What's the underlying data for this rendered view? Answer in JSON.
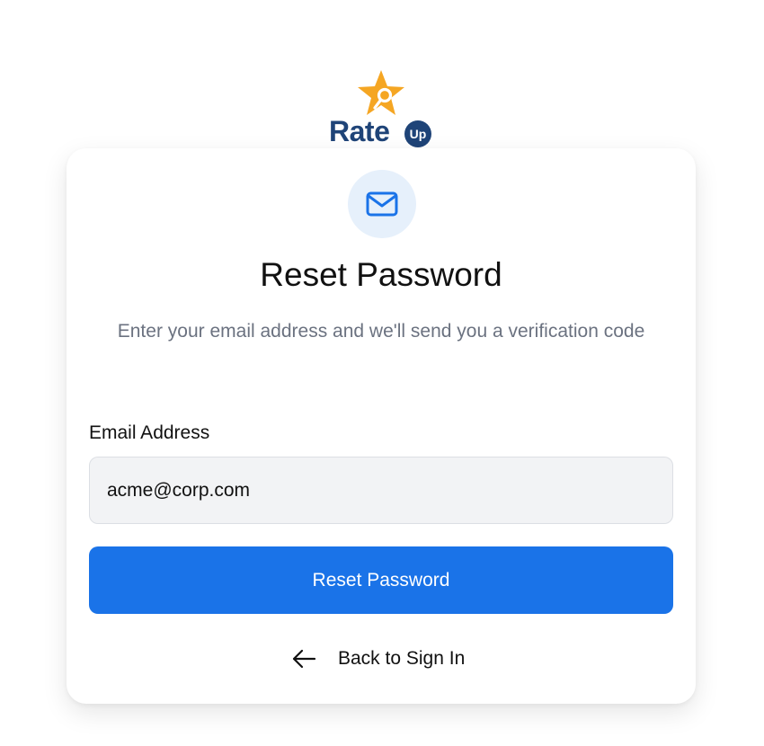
{
  "brand": {
    "logo_text": "Rate",
    "logo_badge": "Up",
    "star_color": "#f5a623",
    "primary_color": "#1f4478"
  },
  "icons": {
    "header_icon": "mail-icon",
    "back_icon": "arrow-left-icon"
  },
  "card": {
    "title": "Reset Password",
    "subtitle": "Enter your email address and we'll send you a verification code"
  },
  "form": {
    "email_label": "Email Address",
    "email_value": "acme@corp.com",
    "submit_label": "Reset Password"
  },
  "footer": {
    "back_label": "Back to Sign In"
  },
  "colors": {
    "accent": "#1a73e8",
    "icon_bg": "#e6f0fb",
    "muted_text": "#6b7280"
  }
}
